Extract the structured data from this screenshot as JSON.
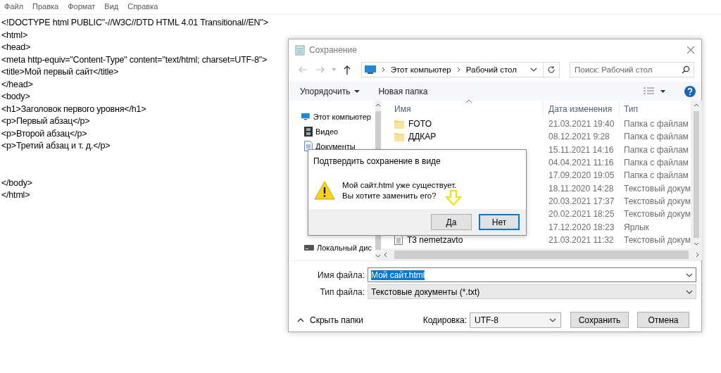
{
  "notepad": {
    "menu": [
      "Файл",
      "Правка",
      "Формат",
      "Вид",
      "Справка"
    ],
    "blocks": [
      [
        "<!DOCTYPE html PUBLIC\"-//W3C//DTD HTML 4.01 Transitional//EN\">",
        "<html>",
        "<head>",
        "<meta http-equiv=\"Content-Type\" content=\"text/html; charset=UTF-8\">",
        "<title>Мой первый сайт</title>",
        "</head>",
        "<body>",
        "<h1>Заголовок первого уровня</h1>",
        "<p>Первый абзац</p>",
        "<p>Второй абзац</p>",
        "<p>Третий абзац и т. д.</p>"
      ],
      [
        "</body>",
        "</html>"
      ]
    ]
  },
  "save_dialog": {
    "title": "Сохранение",
    "address": {
      "path": [
        "Этот компьютер",
        "Рабочий стол"
      ]
    },
    "search": {
      "placeholder": "Поиск: Рабочий стол"
    },
    "toolbar": {
      "organize": "Упорядочить",
      "new_folder": "Новая папка"
    },
    "nav_top": [
      {
        "label": "Этот компьютер",
        "kind": "computer"
      },
      {
        "label": "Видео",
        "kind": "video"
      },
      {
        "label": "Документы",
        "kind": "document"
      }
    ],
    "nav_bottom": [
      {
        "label": "Локальный дис",
        "kind": "drive"
      }
    ],
    "columns": [
      "Имя",
      "Дата изменения",
      "Тип"
    ],
    "rows": [
      {
        "name": "FOTO",
        "kind": "folder",
        "date": "21.03.2021 19:40",
        "type": "Папка с файлам"
      },
      {
        "name": "ДДКАР",
        "kind": "folder",
        "date": "08.12.2021 9:28",
        "type": "Папка с файлам"
      },
      {
        "date": "15.11.2021 14:16",
        "type": "Папка с файлам"
      },
      {
        "date": "04.04.2021 11:16",
        "type": "Папка с файлам"
      },
      {
        "date": "17.09.2020 19:05",
        "type": "Папка с файлам"
      },
      {
        "date": "18.11.2020 14:28",
        "type": "Текстовый докум"
      },
      {
        "date": "20.03.2021 17:37",
        "type": "Текстовый докум"
      },
      {
        "date": "20.02.2021 18:25",
        "type": "Текстовый докум"
      },
      {
        "date": "17.12.2020 18:23",
        "type": "Ярлык"
      },
      {
        "name": "Т3 nemetzavto",
        "kind": "text",
        "date": "21.03.2021 11:32",
        "type": "Текстовый докум"
      }
    ],
    "file_name": {
      "label": "Имя файла:",
      "value": "Мой сайт.html",
      "selected": true
    },
    "file_type": {
      "label": "Тип файла:",
      "value": "Текстовые документы (*.txt)"
    },
    "hide_folders": "Скрыть папки",
    "encoding": {
      "label": "Кодировка:",
      "value": "UTF-8"
    },
    "buttons": [
      {
        "label": "Сохранить",
        "default": false
      },
      {
        "label": "Отмена",
        "default": false
      }
    ]
  },
  "confirm": {
    "title": "Подтвердить сохранение в виде",
    "message": [
      "Мой сайт.html уже существует.",
      "Вы хотите заменить его?"
    ],
    "buttons": [
      {
        "label": "Да",
        "default": false
      },
      {
        "label": "Нет",
        "default": true
      }
    ]
  }
}
